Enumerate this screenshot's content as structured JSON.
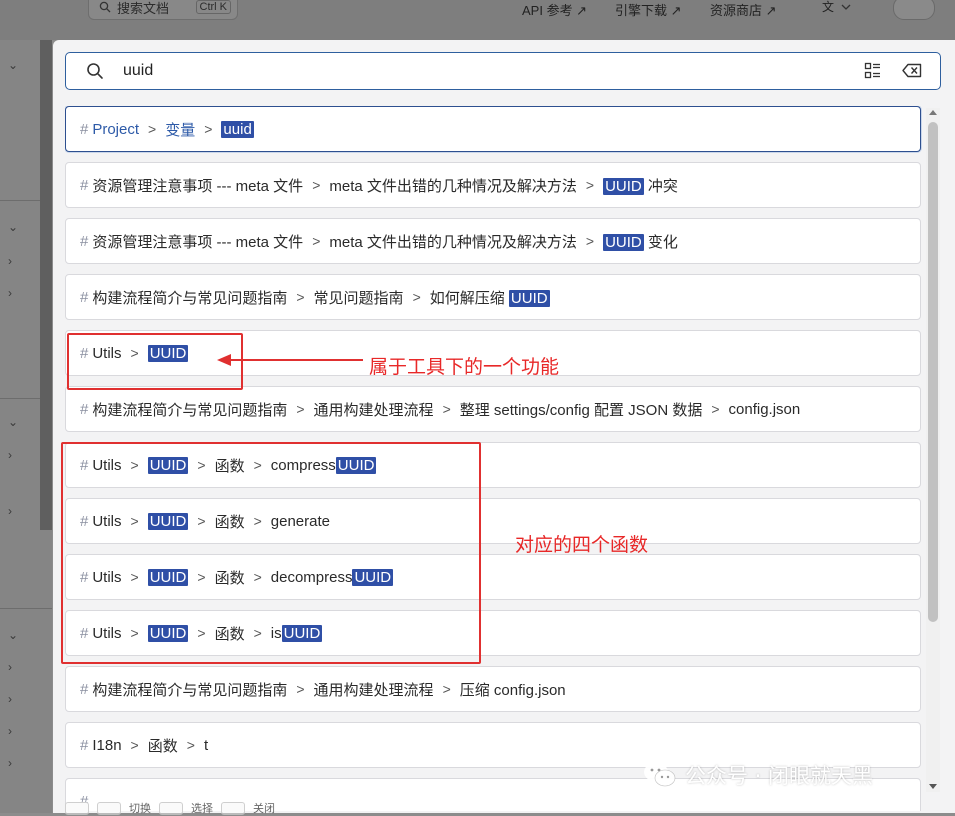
{
  "background": {
    "search_placeholder": "搜索文档",
    "search_shortcut": "Ctrl K",
    "nav": [
      "API 参考 ↗",
      "引擎下载 ↗",
      "资源商店 ↗"
    ],
    "lang_icon": "translate-icon"
  },
  "modal": {
    "search": {
      "value": "uuid"
    },
    "results": [
      {
        "segments": [
          {
            "t": "Project"
          },
          {
            "t": "变量"
          },
          {
            "t": "",
            "h": "uuid"
          }
        ]
      },
      {
        "segments": [
          {
            "t": "资源管理注意事项 --- meta 文件"
          },
          {
            "t": "meta 文件出错的几种情况及解决方法"
          },
          {
            "t": " 冲突",
            "h": "UUID"
          }
        ]
      },
      {
        "segments": [
          {
            "t": "资源管理注意事项 --- meta 文件"
          },
          {
            "t": "meta 文件出错的几种情况及解决方法"
          },
          {
            "t": " 变化",
            "h": "UUID"
          }
        ]
      },
      {
        "segments": [
          {
            "t": "构建流程简介与常见问题指南"
          },
          {
            "t": "常见问题指南"
          },
          {
            "t": "如何解压缩 ",
            "h": "UUID",
            "hfirst": false
          }
        ]
      },
      {
        "segments": [
          {
            "t": "Utils"
          },
          {
            "t": "",
            "h": "UUID"
          }
        ]
      },
      {
        "segments": [
          {
            "t": "构建流程简介与常见问题指南"
          },
          {
            "t": "通用构建处理流程"
          },
          {
            "t": "整理 settings/config 配置 JSON 数据"
          },
          {
            "t": "config.json"
          }
        ]
      },
      {
        "segments": [
          {
            "t": "Utils"
          },
          {
            "t": "",
            "h": "UUID"
          },
          {
            "t": "函数"
          },
          {
            "t": "compress",
            "h": "UUID",
            "hfirst": false
          }
        ]
      },
      {
        "segments": [
          {
            "t": "Utils"
          },
          {
            "t": "",
            "h": "UUID"
          },
          {
            "t": "函数"
          },
          {
            "t": "generate"
          }
        ]
      },
      {
        "segments": [
          {
            "t": "Utils"
          },
          {
            "t": "",
            "h": "UUID"
          },
          {
            "t": "函数"
          },
          {
            "t": "decompress",
            "h": "UUID",
            "hfirst": false
          }
        ]
      },
      {
        "segments": [
          {
            "t": "Utils"
          },
          {
            "t": "",
            "h": "UUID"
          },
          {
            "t": "函数"
          },
          {
            "t": "is",
            "h": "UUID",
            "hfirst": false
          }
        ]
      },
      {
        "segments": [
          {
            "t": "构建流程简介与常见问题指南"
          },
          {
            "t": "通用构建处理流程"
          },
          {
            "t": "压缩 config.json"
          }
        ]
      },
      {
        "segments": [
          {
            "t": "I18n"
          },
          {
            "t": "函数"
          },
          {
            "t": "t"
          }
        ]
      },
      {
        "segments": [
          {
            "t": ""
          }
        ]
      }
    ],
    "footer": [
      "切换",
      "选择",
      "关闭"
    ]
  },
  "annotations": {
    "utils_note": "属于工具下的一个功能",
    "functions_note": "对应的四个函数"
  },
  "watermark": "公众号 · 闭眼就天黑",
  "colors": {
    "highlight": "#2f4fa6",
    "annotation": "#e03030",
    "selected_border": "#2d4f8f"
  }
}
